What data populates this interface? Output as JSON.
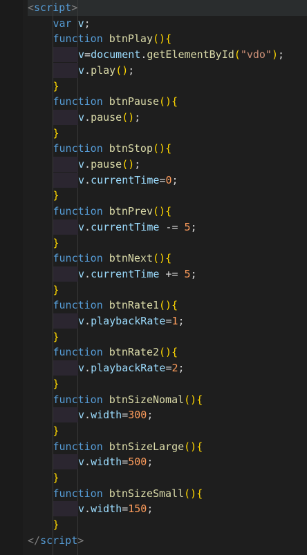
{
  "editor": {
    "lines": [
      {
        "indent": 0,
        "tokens": [
          {
            "t": "<",
            "c": "bracket"
          },
          {
            "t": "script",
            "c": "tag"
          },
          {
            "t": ">",
            "c": "bracket"
          }
        ]
      },
      {
        "indent": 1,
        "tokens": [
          {
            "t": "var ",
            "c": "kw-blue"
          },
          {
            "t": "v",
            "c": "var"
          },
          {
            "t": ";",
            "c": "punct"
          }
        ]
      },
      {
        "indent": 1,
        "tokens": [
          {
            "t": "function ",
            "c": "kw-blue"
          },
          {
            "t": "btnPlay",
            "c": "fn"
          },
          {
            "t": "()",
            "c": "paren"
          },
          {
            "t": "{",
            "c": "brace"
          }
        ]
      },
      {
        "indent": 2,
        "tokens": [
          {
            "t": "v",
            "c": "var"
          },
          {
            "t": "=",
            "c": "punct"
          },
          {
            "t": "document",
            "c": "var"
          },
          {
            "t": ".",
            "c": "punct"
          },
          {
            "t": "getElementById",
            "c": "fn"
          },
          {
            "t": "(",
            "c": "paren"
          },
          {
            "t": "\"vdo\"",
            "c": "str"
          },
          {
            "t": ")",
            "c": "paren"
          },
          {
            "t": ";",
            "c": "punct"
          }
        ]
      },
      {
        "indent": 2,
        "tokens": [
          {
            "t": "v",
            "c": "var"
          },
          {
            "t": ".",
            "c": "punct"
          },
          {
            "t": "play",
            "c": "fn"
          },
          {
            "t": "()",
            "c": "paren"
          },
          {
            "t": ";",
            "c": "punct"
          }
        ]
      },
      {
        "indent": 1,
        "tokens": [
          {
            "t": "}",
            "c": "brace"
          }
        ]
      },
      {
        "indent": 1,
        "tokens": [
          {
            "t": "function ",
            "c": "kw-blue"
          },
          {
            "t": "btnPause",
            "c": "fn"
          },
          {
            "t": "()",
            "c": "paren"
          },
          {
            "t": "{",
            "c": "brace"
          }
        ]
      },
      {
        "indent": 2,
        "tokens": [
          {
            "t": "v",
            "c": "var"
          },
          {
            "t": ".",
            "c": "punct"
          },
          {
            "t": "pause",
            "c": "fn"
          },
          {
            "t": "()",
            "c": "paren"
          },
          {
            "t": ";",
            "c": "punct"
          }
        ]
      },
      {
        "indent": 1,
        "tokens": [
          {
            "t": "}",
            "c": "brace"
          }
        ]
      },
      {
        "indent": 1,
        "tokens": [
          {
            "t": "function ",
            "c": "kw-blue"
          },
          {
            "t": "btnStop",
            "c": "fn"
          },
          {
            "t": "()",
            "c": "paren"
          },
          {
            "t": "{",
            "c": "brace"
          }
        ]
      },
      {
        "indent": 2,
        "tokens": [
          {
            "t": "v",
            "c": "var"
          },
          {
            "t": ".",
            "c": "punct"
          },
          {
            "t": "pause",
            "c": "fn"
          },
          {
            "t": "()",
            "c": "paren"
          },
          {
            "t": ";",
            "c": "punct"
          }
        ]
      },
      {
        "indent": 2,
        "tokens": [
          {
            "t": "v",
            "c": "var"
          },
          {
            "t": ".",
            "c": "punct"
          },
          {
            "t": "currentTime",
            "c": "prop"
          },
          {
            "t": "=",
            "c": "punct"
          },
          {
            "t": "0",
            "c": "num-orange"
          },
          {
            "t": ";",
            "c": "punct"
          }
        ]
      },
      {
        "indent": 1,
        "tokens": [
          {
            "t": "}",
            "c": "brace"
          }
        ]
      },
      {
        "indent": 1,
        "tokens": [
          {
            "t": "function ",
            "c": "kw-blue"
          },
          {
            "t": "btnPrev",
            "c": "fn"
          },
          {
            "t": "()",
            "c": "paren"
          },
          {
            "t": "{",
            "c": "brace"
          }
        ]
      },
      {
        "indent": 2,
        "tokens": [
          {
            "t": "v",
            "c": "var"
          },
          {
            "t": ".",
            "c": "punct"
          },
          {
            "t": "currentTime",
            "c": "prop"
          },
          {
            "t": " -= ",
            "c": "punct"
          },
          {
            "t": "5",
            "c": "num-orange"
          },
          {
            "t": ";",
            "c": "punct"
          }
        ]
      },
      {
        "indent": 1,
        "tokens": [
          {
            "t": "}",
            "c": "brace"
          }
        ]
      },
      {
        "indent": 1,
        "tokens": [
          {
            "t": "function ",
            "c": "kw-blue"
          },
          {
            "t": "btnNext",
            "c": "fn"
          },
          {
            "t": "()",
            "c": "paren"
          },
          {
            "t": "{",
            "c": "brace"
          }
        ]
      },
      {
        "indent": 2,
        "tokens": [
          {
            "t": "v",
            "c": "var"
          },
          {
            "t": ".",
            "c": "punct"
          },
          {
            "t": "currentTime",
            "c": "prop"
          },
          {
            "t": " += ",
            "c": "punct"
          },
          {
            "t": "5",
            "c": "num-orange"
          },
          {
            "t": ";",
            "c": "punct"
          }
        ]
      },
      {
        "indent": 1,
        "tokens": [
          {
            "t": "}",
            "c": "brace"
          }
        ]
      },
      {
        "indent": 1,
        "tokens": [
          {
            "t": "function ",
            "c": "kw-blue"
          },
          {
            "t": "btnRate1",
            "c": "fn"
          },
          {
            "t": "()",
            "c": "paren"
          },
          {
            "t": "{",
            "c": "brace"
          }
        ]
      },
      {
        "indent": 2,
        "tokens": [
          {
            "t": "v",
            "c": "var"
          },
          {
            "t": ".",
            "c": "punct"
          },
          {
            "t": "playbackRate",
            "c": "prop"
          },
          {
            "t": "=",
            "c": "punct"
          },
          {
            "t": "1",
            "c": "num-orange"
          },
          {
            "t": ";",
            "c": "punct"
          }
        ]
      },
      {
        "indent": 1,
        "tokens": [
          {
            "t": "}",
            "c": "brace"
          }
        ]
      },
      {
        "indent": 1,
        "tokens": [
          {
            "t": "function ",
            "c": "kw-blue"
          },
          {
            "t": "btnRate2",
            "c": "fn"
          },
          {
            "t": "()",
            "c": "paren"
          },
          {
            "t": "{",
            "c": "brace"
          }
        ]
      },
      {
        "indent": 2,
        "tokens": [
          {
            "t": "v",
            "c": "var"
          },
          {
            "t": ".",
            "c": "punct"
          },
          {
            "t": "playbackRate",
            "c": "prop"
          },
          {
            "t": "=",
            "c": "punct"
          },
          {
            "t": "2",
            "c": "num-orange"
          },
          {
            "t": ";",
            "c": "punct"
          }
        ]
      },
      {
        "indent": 1,
        "tokens": [
          {
            "t": "}",
            "c": "brace"
          }
        ]
      },
      {
        "indent": 1,
        "tokens": [
          {
            "t": "function ",
            "c": "kw-blue"
          },
          {
            "t": "btnSizeNomal",
            "c": "fn"
          },
          {
            "t": "()",
            "c": "paren"
          },
          {
            "t": "{",
            "c": "brace"
          }
        ]
      },
      {
        "indent": 2,
        "tokens": [
          {
            "t": "v",
            "c": "var"
          },
          {
            "t": ".",
            "c": "punct"
          },
          {
            "t": "width",
            "c": "prop"
          },
          {
            "t": "=",
            "c": "punct"
          },
          {
            "t": "300",
            "c": "num-orange"
          },
          {
            "t": ";",
            "c": "punct"
          }
        ]
      },
      {
        "indent": 1,
        "tokens": [
          {
            "t": "}",
            "c": "brace"
          }
        ]
      },
      {
        "indent": 1,
        "tokens": [
          {
            "t": "function ",
            "c": "kw-blue"
          },
          {
            "t": "btnSizeLarge",
            "c": "fn"
          },
          {
            "t": "()",
            "c": "paren"
          },
          {
            "t": "{",
            "c": "brace"
          }
        ]
      },
      {
        "indent": 2,
        "tokens": [
          {
            "t": "v",
            "c": "var"
          },
          {
            "t": ".",
            "c": "punct"
          },
          {
            "t": "width",
            "c": "prop"
          },
          {
            "t": "=",
            "c": "punct"
          },
          {
            "t": "500",
            "c": "num-orange"
          },
          {
            "t": ";",
            "c": "punct"
          }
        ]
      },
      {
        "indent": 1,
        "tokens": [
          {
            "t": "}",
            "c": "brace"
          }
        ]
      },
      {
        "indent": 1,
        "tokens": [
          {
            "t": "function ",
            "c": "kw-blue"
          },
          {
            "t": "btnSizeSmall",
            "c": "fn"
          },
          {
            "t": "()",
            "c": "paren"
          },
          {
            "t": "{",
            "c": "brace"
          }
        ]
      },
      {
        "indent": 2,
        "tokens": [
          {
            "t": "v",
            "c": "var"
          },
          {
            "t": ".",
            "c": "punct"
          },
          {
            "t": "width",
            "c": "prop"
          },
          {
            "t": "=",
            "c": "punct"
          },
          {
            "t": "150",
            "c": "num-orange"
          },
          {
            "t": ";",
            "c": "punct"
          }
        ]
      },
      {
        "indent": 1,
        "tokens": [
          {
            "t": "}",
            "c": "brace"
          }
        ]
      },
      {
        "indent": 0,
        "tokens": [
          {
            "t": "</",
            "c": "bracket"
          },
          {
            "t": "script",
            "c": "tag"
          },
          {
            "t": ">",
            "c": "bracket"
          }
        ]
      }
    ]
  },
  "colors": {
    "background": "#1e1e1e",
    "gutter": "#1b1b1b",
    "keyword": "#569cd6",
    "function": "#dcdcaa",
    "variable": "#9cdcfe",
    "string": "#ce9178",
    "number": "#ff9d5c",
    "bracket_gold": "#ffd700"
  }
}
